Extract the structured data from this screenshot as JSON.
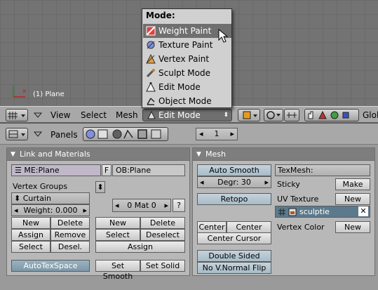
{
  "viewport": {
    "object_label": "(1) Plane"
  },
  "mode_menu": {
    "title": "Mode:",
    "items": [
      {
        "label": "Weight Paint",
        "icon": "weight-paint-icon",
        "highlighted": true
      },
      {
        "label": "Texture Paint",
        "icon": "texture-paint-icon",
        "highlighted": false
      },
      {
        "label": "Vertex Paint",
        "icon": "vertex-paint-icon",
        "highlighted": false
      },
      {
        "label": "Sculpt Mode",
        "icon": "sculpt-mode-icon",
        "highlighted": false
      },
      {
        "label": "Edit Mode",
        "icon": "edit-mode-icon",
        "highlighted": false
      },
      {
        "label": "Object Mode",
        "icon": "object-mode-icon",
        "highlighted": false
      }
    ]
  },
  "header": {
    "menus": [
      "View",
      "Select",
      "Mesh"
    ],
    "mode_value": "Edit Mode",
    "overflow_text": "Glob"
  },
  "buttons_header": {
    "panels_label": "Panels",
    "frame_value": "1"
  },
  "link_materials": {
    "title": "Link and Materials",
    "me_field": "ME:Plane",
    "f_label": "F",
    "ob_field": "OB:Plane",
    "vertex_groups_label": "Vertex Groups",
    "group_name": "Curtain",
    "weight": "Weight: 0.000",
    "mat_value": "0 Mat 0",
    "mat_help": "?",
    "vg_buttons": {
      "new": "New",
      "delete": "Delete",
      "assign": "Assign",
      "remove": "Remove",
      "select": "Select",
      "desel": "Desel."
    },
    "mat_buttons": {
      "new": "New",
      "delete": "Delete",
      "select": "Select",
      "deselect": "Deselect",
      "assign": "Assign"
    },
    "autotexspace": "AutoTexSpace",
    "set_smooth": "Set Smooth",
    "set_solid": "Set Solid"
  },
  "mesh": {
    "title": "Mesh",
    "auto_smooth": "Auto Smooth",
    "degr": "Degr: 30",
    "retopo": "Retopo",
    "center": "Center",
    "center_new": "Center New",
    "center_cursor": "Center Cursor",
    "double_sided": "Double Sided",
    "no_vnormal_flip": "No V.Normal Flip",
    "texmesh": "TexMesh:",
    "sticky_label": "Sticky",
    "sticky_btn": "Make",
    "uv_label": "UV Texture",
    "uv_btn": "New",
    "uv_name": "sculptie",
    "vertex_color_label": "Vertex Color",
    "vertex_color_btn": "New"
  }
}
